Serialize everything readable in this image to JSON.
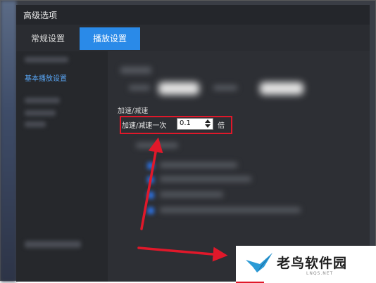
{
  "dialog": {
    "title": "高级选项",
    "tabs": [
      {
        "label": "常规设置",
        "active": false
      },
      {
        "label": "播放设置",
        "active": true
      }
    ]
  },
  "sidebar": {
    "active_item": "基本播放设置"
  },
  "speed_setting": {
    "section_label": "加速/减速",
    "label": "加速/减速一次",
    "value": "0.1",
    "unit": "倍"
  },
  "watermark": {
    "text": "老鸟软件园",
    "sub": "LNQS.NET"
  },
  "colors": {
    "accent": "#2a8ae8",
    "annotation_red": "#e0182a",
    "sidebar_active": "#59a6f5"
  }
}
